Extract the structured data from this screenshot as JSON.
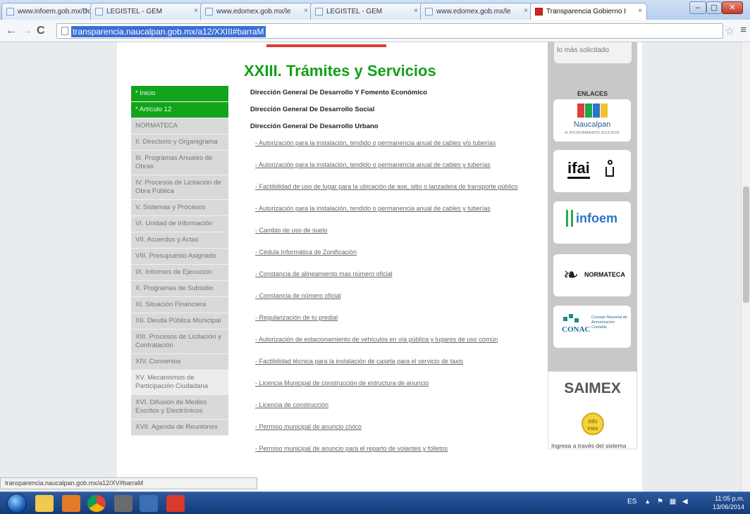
{
  "browser": {
    "tabs": [
      {
        "label": "www.infoem.gob.mx/Doc",
        "active": false
      },
      {
        "label": "LEGISTEL - GEM",
        "active": false
      },
      {
        "label": "www.edomex.gob.mx/le",
        "active": false
      },
      {
        "label": "LEGISTEL - GEM",
        "active": false
      },
      {
        "label": "www.edomex.gob.mx/le",
        "active": false
      },
      {
        "label": "Transparencia Gobierno I",
        "active": true
      }
    ],
    "url": "transparencia.naucalpan.gob.mx/a12/XXIII#barraM",
    "status_url": "transparencia.naucalpan.gob.mx/a12/XV#barraM"
  },
  "sidebar": {
    "items": [
      {
        "label": "* Inicio",
        "style": "green"
      },
      {
        "label": "* Artículo 12",
        "style": "green"
      },
      {
        "label": "NORMATECA",
        "style": "gray"
      },
      {
        "label": "II. Directorio y Organigrama",
        "style": "gray"
      },
      {
        "label": "III. Programas Anuales de Obras",
        "style": "gray"
      },
      {
        "label": "IV. Procesos de Licitación de Obra Pública",
        "style": "gray"
      },
      {
        "label": "V. Sistemas y Procesos",
        "style": "gray"
      },
      {
        "label": "VI. Unidad de Información",
        "style": "gray"
      },
      {
        "label": "VII. Acuerdos y Actas",
        "style": "gray"
      },
      {
        "label": "VIII. Presupuesto Asignado",
        "style": "gray"
      },
      {
        "label": "IX. Informes de Ejecución",
        "style": "gray"
      },
      {
        "label": "X. Programas de Subsidio",
        "style": "gray"
      },
      {
        "label": "XI. Situación Financiera",
        "style": "gray"
      },
      {
        "label": "XII. Deuda Pública Municipal",
        "style": "gray"
      },
      {
        "label": "XIII. Procesos de Licitación y Contratación",
        "style": "gray"
      },
      {
        "label": "XIV. Convenios",
        "style": "gray"
      },
      {
        "label": "XV. Mecanismos de Participación Ciudadana",
        "style": "light"
      },
      {
        "label": "XVI. Difusión de Medios Escritos y Electrónicos",
        "style": "gray"
      },
      {
        "label": "XVII. Agenda de Reuniones",
        "style": "gray"
      }
    ]
  },
  "main": {
    "title": "XXIII. Trámites y Servicios",
    "departments": [
      "Dirección General De Desarrollo Y Fomento Económico",
      "Dirección General De Desarrollo Social",
      "Dirección General De Desarrollo Urbano"
    ],
    "links": [
      "- Autorización para la instalación, tendido o permanencia anual de cables y/o tuberías",
      "- Autorización para la instalación, tendido o permanencia anual de cables y tuberías",
      "- Factibilidad de uso de lugar para la ubicación de ase, sitio o lanzadera de transporte público",
      "- Autorización para la instalación, tendido o permanencia anual de cables y tuberías",
      "- Cambio de uso de suelo",
      "- Cédula Informática de Zonificación",
      "- Constancia de alineamiento mas número oficial",
      "- Constancia de número oficial",
      "- Regularización de tu predial",
      "- Autorización de estacionamiento de vehículos en vía pública y lugares de uso común",
      "- Factibilidad técnica para la instalación de caseta para el servicio de taxis",
      "- Licencia Municipal de construcción de estructura de anuncio",
      "- Licencia de construcción",
      "- Permiso municipal de anuncio cívico",
      "- Permiso municipal de anuncio para el reparto de volantes y folletos"
    ]
  },
  "rightcol": {
    "top_label": "lo más solicitado",
    "enlaces_title": "ENLACES",
    "logos": [
      {
        "name": "naucalpan-logo",
        "text": "Naucalpan",
        "sub": "H. AYUNTAMIENTO 2013-2015"
      },
      {
        "name": "ifai-logo",
        "text": "ifai"
      },
      {
        "name": "infoem-logo",
        "text": "infoem"
      },
      {
        "name": "normateca-logo",
        "text": "NORMATECA"
      },
      {
        "name": "conac-logo",
        "text": "CONAC",
        "sub": "Consejo Nacional de Armonización Contable"
      }
    ],
    "saimex": {
      "title": "SAIMEX",
      "badge": "info mex",
      "desc": "Ingresa a través del sistema Infomex-Saimex podrás solicitar toda la información pública del"
    }
  },
  "taskbar": {
    "lang": "ES",
    "time": "11:05 p.m.",
    "date": "13/06/2014"
  },
  "colors": {
    "green": "#13a018",
    "nav_green": "#12a41b",
    "red_bar": "#e03c31",
    "accent_blue": "#3b6fd6"
  }
}
